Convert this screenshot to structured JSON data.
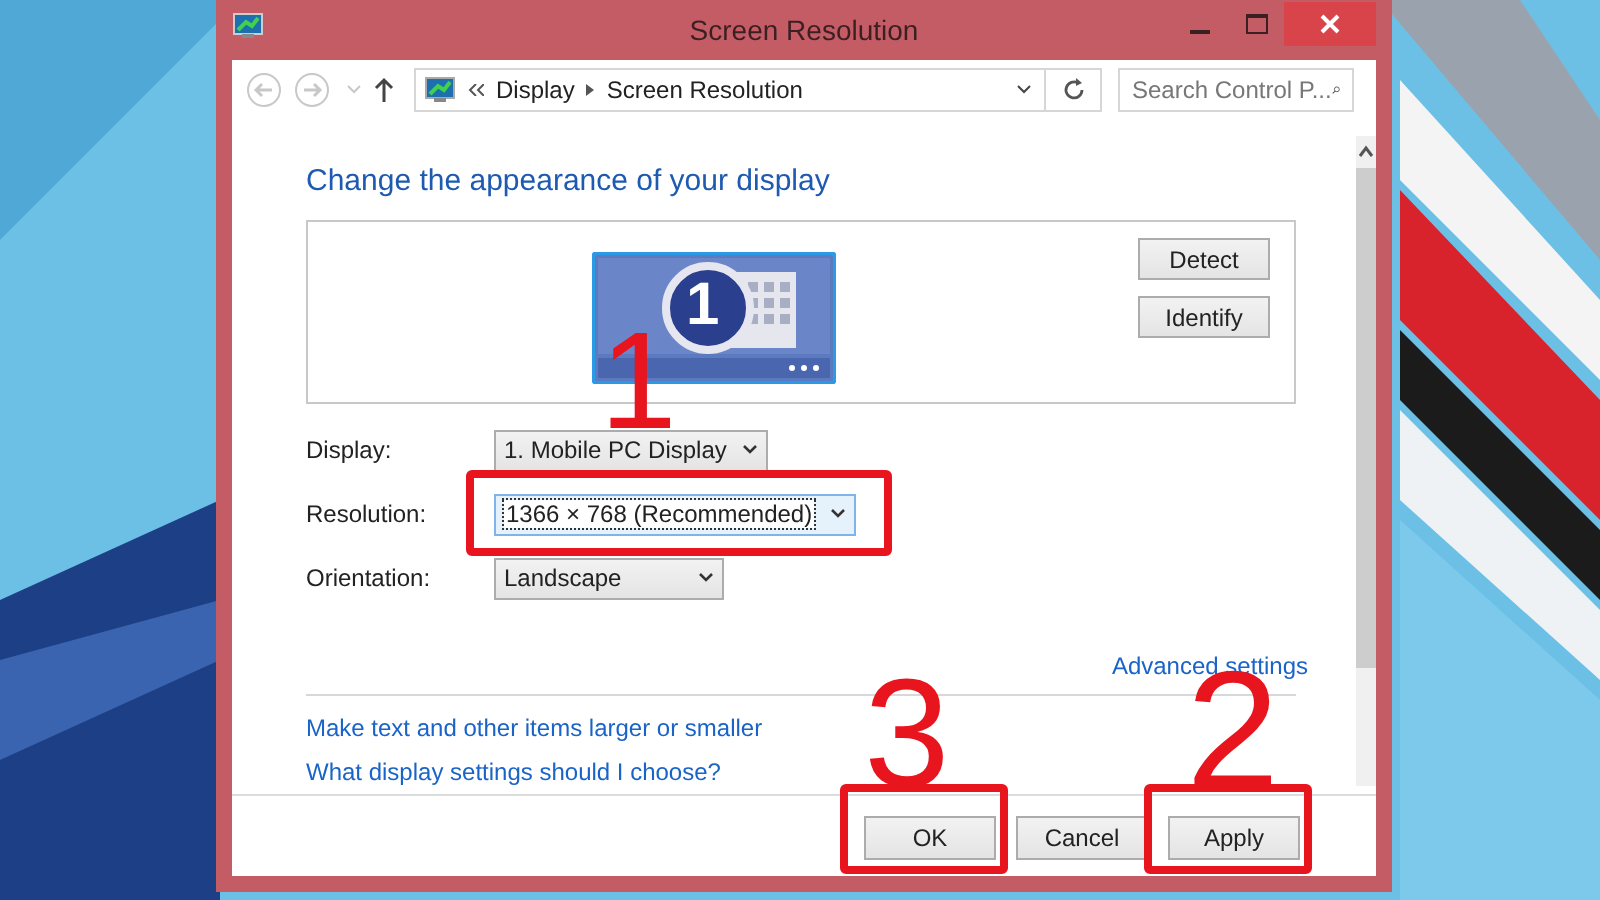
{
  "window": {
    "title": "Screen Resolution"
  },
  "address_bar": {
    "breadcrumbs": [
      "Display",
      "Screen Resolution"
    ]
  },
  "search": {
    "placeholder": "Search Control P..."
  },
  "heading": "Change the appearance of your display",
  "preview": {
    "monitor_number": "1",
    "buttons": [
      "Detect",
      "Identify"
    ]
  },
  "settings": [
    {
      "label": "Display:",
      "value": "1. Mobile PC Display",
      "highlighted": false,
      "focused": false
    },
    {
      "label": "Resolution:",
      "value": "1366 × 768 (Recommended)",
      "highlighted": true,
      "focused": true
    },
    {
      "label": "Orientation:",
      "value": "Landscape",
      "highlighted": false,
      "focused": false
    }
  ],
  "advanced_link": "Advanced settings",
  "links": [
    "Make text and other items larger or smaller",
    "What display settings should I choose?"
  ],
  "footer_buttons": [
    {
      "label": "OK",
      "highlighted": true
    },
    {
      "label": "Cancel",
      "highlighted": false
    },
    {
      "label": "Apply",
      "highlighted": true
    }
  ],
  "annotations": [
    {
      "label": "1"
    },
    {
      "label": "2"
    },
    {
      "label": "3"
    }
  ]
}
